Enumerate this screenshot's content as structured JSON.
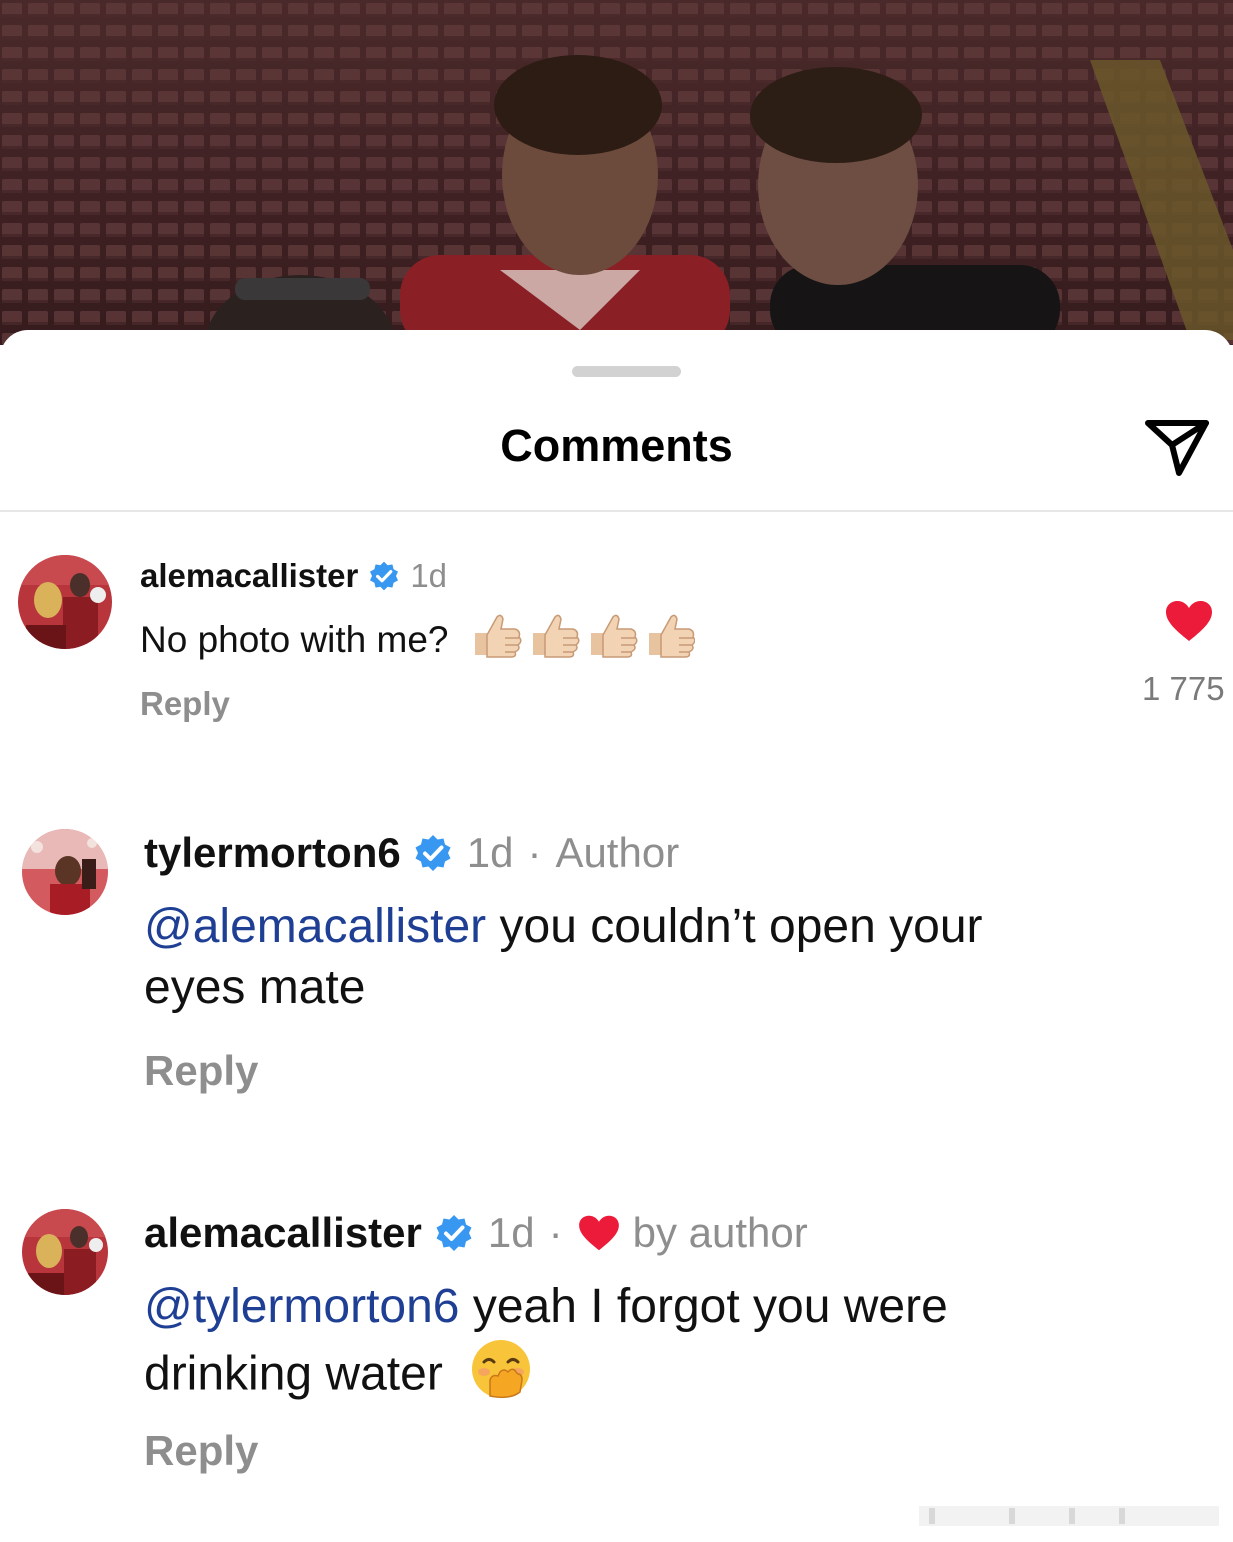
{
  "sheet": {
    "title": "Comments",
    "share_icon": "paper-plane-icon"
  },
  "comments": [
    {
      "username": "alemacallister",
      "verified": true,
      "time": "1d",
      "text": "No photo with me?",
      "emoji": [
        "thumbs-up-light-skin",
        "thumbs-up-light-skin",
        "thumbs-up-light-skin",
        "thumbs-up-light-skin"
      ],
      "reply_label": "Reply",
      "liked": true,
      "like_count": "1 775"
    },
    {
      "username": "tylermorton6",
      "verified": true,
      "time": "1d",
      "separator": "·",
      "author_label": "Author",
      "mention": "@alemacallister",
      "text_line1": " you couldn’t open your",
      "text_line2": "eyes mate",
      "reply_label": "Reply"
    },
    {
      "username": "alemacallister",
      "verified": true,
      "time": "1d",
      "separator": "·",
      "liked_by_author_label": "by author",
      "mention": "@tylermorton6",
      "text_line1": " yeah I forgot you were",
      "text_line2": "drinking water",
      "emoji": [
        "face-with-hand-over-mouth"
      ],
      "reply_label": "Reply"
    }
  ],
  "colors": {
    "verified_blue": "#3897f0",
    "heart_red": "#ed1b3a",
    "mention_blue": "#1e3f94",
    "muted_gray": "#8e8e8e"
  }
}
